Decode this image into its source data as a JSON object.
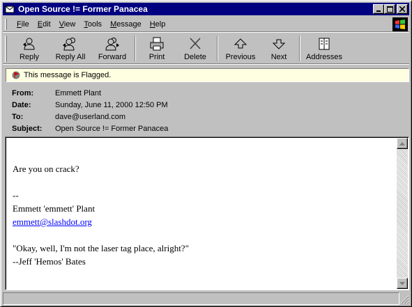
{
  "window": {
    "title": "Open Source != Former Panacea",
    "min_label": "_",
    "max_label": "□",
    "close_label": "✕"
  },
  "menu": [
    {
      "label_u": "F",
      "label_rest": "ile"
    },
    {
      "label_u": "E",
      "label_rest": "dit"
    },
    {
      "label_u": "V",
      "label_rest": "iew"
    },
    {
      "label_u": "T",
      "label_rest": "ools"
    },
    {
      "label_u": "M",
      "label_rest": "essage"
    },
    {
      "label_u": "H",
      "label_rest": "elp"
    }
  ],
  "toolbar": {
    "reply": "Reply",
    "reply_all": "Reply All",
    "forward": "Forward",
    "print": "Print",
    "delete": "Delete",
    "previous": "Previous",
    "next": "Next",
    "addresses": "Addresses"
  },
  "flag": {
    "text": "This message is Flagged."
  },
  "headers": {
    "from_label": "From:",
    "from_value": "Emmett Plant",
    "date_label": "Date:",
    "date_value": "Sunday, June 11, 2000 12:50 PM",
    "to_label": "To:",
    "to_value": "dave@userland.com",
    "subject_label": "Subject:",
    "subject_value": "Open Source != Former Panacea"
  },
  "body": {
    "line1": "Are you on crack?",
    "sig_sep": "--",
    "sig_name": "Emmett 'emmett' Plant",
    "sig_email": "emmett@slashdot.org",
    "quote": "\"Okay, well, I'm not the laser tag place, alright?\"",
    "quote_attrib": "--Jeff 'Hemos' Bates"
  },
  "colors": {
    "titlebar": "#000080",
    "flagbar": "#ffffe1",
    "link": "#0000ff"
  }
}
